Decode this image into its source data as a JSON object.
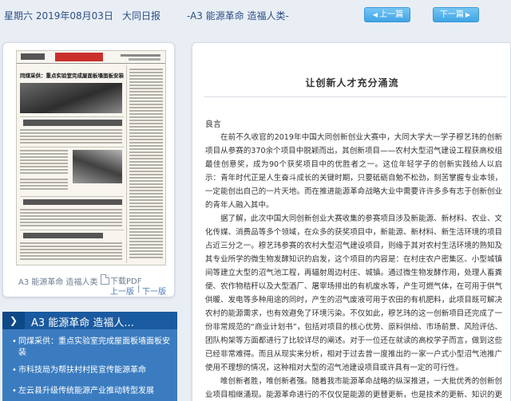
{
  "header": {
    "date": "星期六 2019年08月03日",
    "paper": "大同日报",
    "section": "-A3 能源革命 造福人类-",
    "prev_label": "上一篇",
    "next_label": "下一篇"
  },
  "thumbnail": {
    "page_label": "A3 能源革命 造福人类",
    "pdf_label": "下载PDF",
    "prev_page": "上一版",
    "next_page": "下一版",
    "pager_sep": "|",
    "headline": "同煤采供：重点实验室完成屋面板墙面板安装"
  },
  "sidebar": {
    "section_title": "A3 能源革命 造福人...",
    "items": [
      {
        "title": "同煤采供：重点实验室完成屋面板墙面板安装"
      },
      {
        "title": "市科技局为帮扶村村民宣传能源革命"
      },
      {
        "title": "左云县升级传统能源产业推动转型发展"
      }
    ]
  },
  "article": {
    "title": "让创新人才充分涌流",
    "author": "良言",
    "paragraphs": [
      "在前不久收官的2019年中国大同创新创业大赛中，大同大学大一学子穆艺玮的创新项目从参赛的370余个项目中脱颖而出，其创新项目——农村大型沼气建设工程获高校组最佳创意奖，成为90个获奖项目中的优胜者之一。这位年轻学子的创新实践给人以启示：青年时代正是人生奋斗成长的关键时期，只要砥砺自勉不松劲，刻苦掌握专业本领，一定能创出自己的一片天地。而在推进能源革命战略大业中需要许许多多有志于创新创业的青年人融入其中。",
      "据了解，此次中国大同创新创业大赛收集的参赛项目涉及新能源、新材料、农业、文化传媒、消费品等多个领域，在众多的获奖项目中，新能源、新材料、新生活环境的项目占近三分之一。穆艺玮参赛的农村大型沼气建设项目，则缘于其对农村生活环境的熟知及其专业所学的微生物发酵知识的启发，这个项目的内容是：在村庄农户密集区、小型城镇间等建立大型的沼气池工程，再辐射周边村庄、城镇。通过微生物发酵作用，处理人畜粪便、农作物秸秆以及大型酒厂、屠宰场排出的有机废水等，产生可燃气体，在可用于供气供暖、发电等多种用途的同时，产生的沼气废液可用于农田的有机肥料，此项目既可解决农村的能源需求，也有效避免了环境污染。不仅如此，穆艺玮的这一创新项目还完成了一份非常规范的“商业计划书”，包括对项目的核心优势、原料供给、市场前景、风险评估、团队构架等方面都进行了比较详尽的阐述。对于一位还在就读的高校学子而言，做到这些已经非常难得。而且从现实来分析，相对于过去曾一度推出的一家一户式小型沼气池推广使用不理想的情况，这种相对大型的沼气池建设项目或许具有一定的可行性。",
      "唯创新者胜，唯创新者强。随着我市能源革命战略的纵深推进，一大批优秀的创新创业项目相继涌现。能源革命进行的不仅仅是能源的更替更新，也是技术的更新、知识的更新。"
    ]
  }
}
